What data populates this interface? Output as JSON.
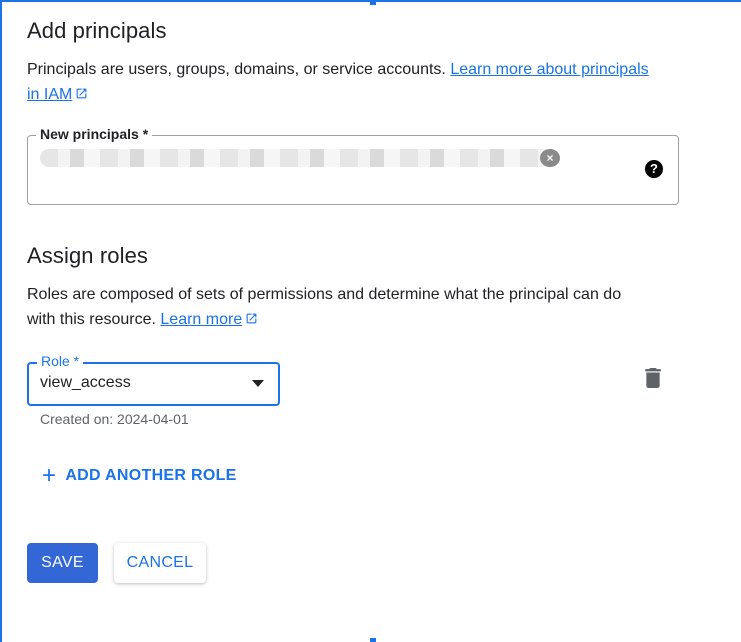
{
  "add_principals": {
    "heading": "Add principals",
    "description": "Principals are users, groups, domains, or service accounts.",
    "learn_more_line1": "Learn more about principals",
    "learn_more_line2": "in IAM",
    "field_label": "New principals *",
    "help_icon": "question-circle-icon",
    "chip_close_icon": "close-icon"
  },
  "assign_roles": {
    "heading": "Assign roles",
    "description_line1": "Roles are composed of sets of permissions and determine what the principal can do",
    "description_line2": "with this resource.",
    "learn_more": "Learn more",
    "role_label": "Role *",
    "role_value": "view_access",
    "role_helper": "Created on: 2024-04-01",
    "delete_icon": "trash-icon",
    "add_another_role": "ADD ANOTHER ROLE"
  },
  "actions": {
    "save": "SAVE",
    "cancel": "CANCEL"
  },
  "colors": {
    "accent": "#1a73e8",
    "primary_button": "#3367d6",
    "text": "#202124",
    "muted": "#5f6368"
  }
}
